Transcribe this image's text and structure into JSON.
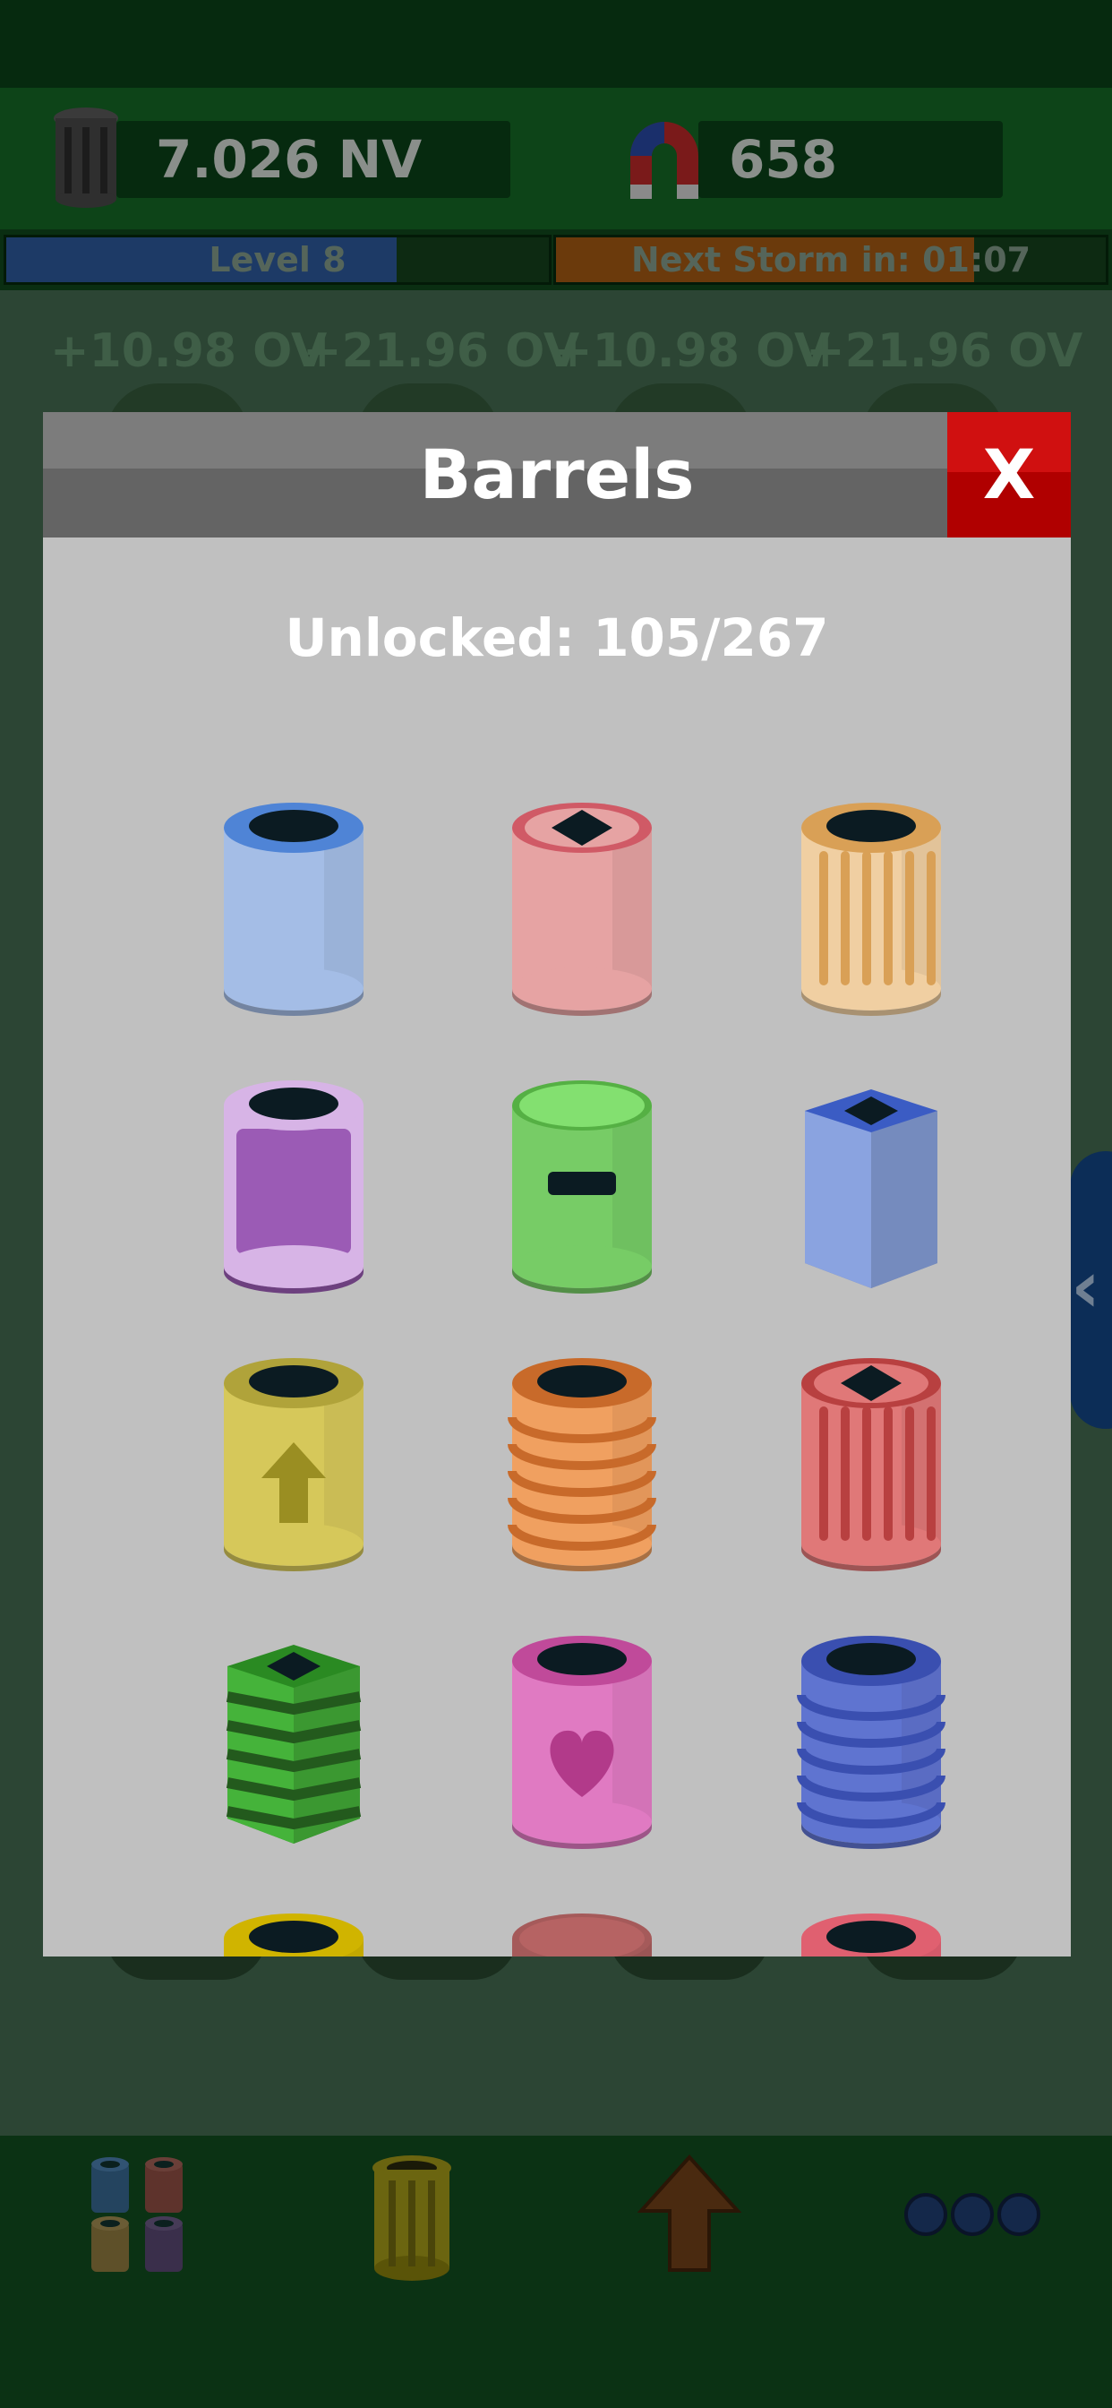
{
  "hud": {
    "trash_value": "7.026 NV",
    "magnet_value": "658",
    "level_label": "Level 8",
    "storm_label": "Next Storm in: 01:07"
  },
  "earnings": [
    "+10.98 OV",
    "+21.96 OV",
    "+10.98 OV",
    "+21.96 OV"
  ],
  "modal": {
    "title": "Barrels",
    "close_label": "X",
    "unlocked_text": "Unlocked: 105/267"
  },
  "barrels": [
    {
      "name": "blue",
      "shape": "cylinder",
      "color": "#a4bde6",
      "rim": "#4f84d6",
      "hole": "round",
      "decor": "none"
    },
    {
      "name": "pink",
      "shape": "cylinder",
      "color": "#e6a3a3",
      "rim": "#d05a66",
      "hole": "diamond",
      "decor": "none"
    },
    {
      "name": "tan-ribbed",
      "shape": "cylinder",
      "color": "#f0cfa2",
      "rim": "#d9a056",
      "hole": "round",
      "decor": "vstripes"
    },
    {
      "name": "purple",
      "shape": "cylinder",
      "color": "#9b5bb5",
      "rim": "#d7b4e6",
      "hole": "round",
      "decor": "band"
    },
    {
      "name": "green-slot",
      "shape": "cylinder",
      "color": "#77cc66",
      "rim": "#55b044",
      "hole": "lid",
      "decor": "slot"
    },
    {
      "name": "blue-box",
      "shape": "box",
      "color": "#8aa3e0",
      "rim": "#3b5cc4",
      "hole": "diamond",
      "decor": "none"
    },
    {
      "name": "yellow-arrow",
      "shape": "cylinder",
      "color": "#d6c85a",
      "rim": "#b0a33a",
      "hole": "round",
      "decor": "arrow"
    },
    {
      "name": "orange-rings",
      "shape": "cylinder",
      "color": "#f0a060",
      "rim": "#c86a2a",
      "hole": "round",
      "decor": "hstripes"
    },
    {
      "name": "red-ribbed",
      "shape": "cylinder",
      "color": "#e07878",
      "rim": "#b84040",
      "hole": "diamond",
      "decor": "vstripes"
    },
    {
      "name": "green-box-striped",
      "shape": "box",
      "color": "#45b33a",
      "rim": "#2a8a22",
      "hole": "diamond",
      "decor": "hstripes"
    },
    {
      "name": "magenta-heart",
      "shape": "cylinder",
      "color": "#e07ac2",
      "rim": "#c04a9a",
      "hole": "round",
      "decor": "heart"
    },
    {
      "name": "blue-rings",
      "shape": "cylinder",
      "color": "#5f74d0",
      "rim": "#3a4fb0",
      "hole": "round",
      "decor": "hstripes"
    },
    {
      "name": "yellow-partial",
      "shape": "cylinder",
      "color": "#d0b400",
      "rim": "#d0b400",
      "hole": "round",
      "decor": "none"
    },
    {
      "name": "mauve-partial",
      "shape": "cylinder",
      "color": "#a55a5a",
      "rim": "#a55a5a",
      "hole": "lid",
      "decor": "none"
    },
    {
      "name": "red-partial",
      "shape": "cylinder",
      "color": "#e06070",
      "rim": "#e06070",
      "hole": "round",
      "decor": "none"
    }
  ],
  "nav": {
    "items": [
      "barrels-collection-icon",
      "trash-can-icon",
      "upgrade-arrow-icon",
      "more-dots-icon"
    ]
  }
}
